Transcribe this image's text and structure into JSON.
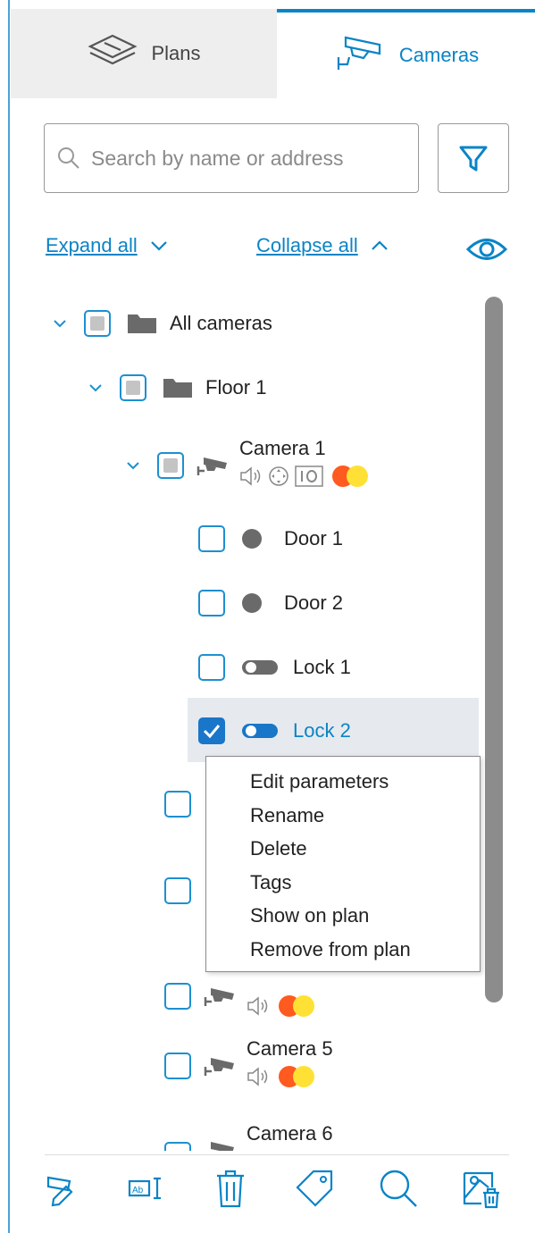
{
  "tabs": {
    "plans": "Plans",
    "cameras": "Cameras"
  },
  "search": {
    "placeholder": "Search by name or address"
  },
  "links": {
    "expand_all": "Expand all",
    "collapse_all": "Collapse all"
  },
  "tree": {
    "all_cameras": "All cameras",
    "floor_1": "Floor 1",
    "camera_1": "Camera 1",
    "door_1": "Door 1",
    "door_2": "Door 2",
    "lock_1": "Lock 1",
    "lock_2": "Lock 2",
    "camera_5": "Camera 5",
    "camera_6": "Camera 6"
  },
  "context_menu": {
    "items": [
      "Edit parameters",
      "Rename",
      "Delete",
      "Tags",
      "Show on plan",
      "Remove from plan"
    ]
  },
  "colors": {
    "accent": "#0a84c6",
    "checkbox": "#1d8fd1",
    "orange": "#ff5a1f",
    "yellow": "#ffe135"
  }
}
